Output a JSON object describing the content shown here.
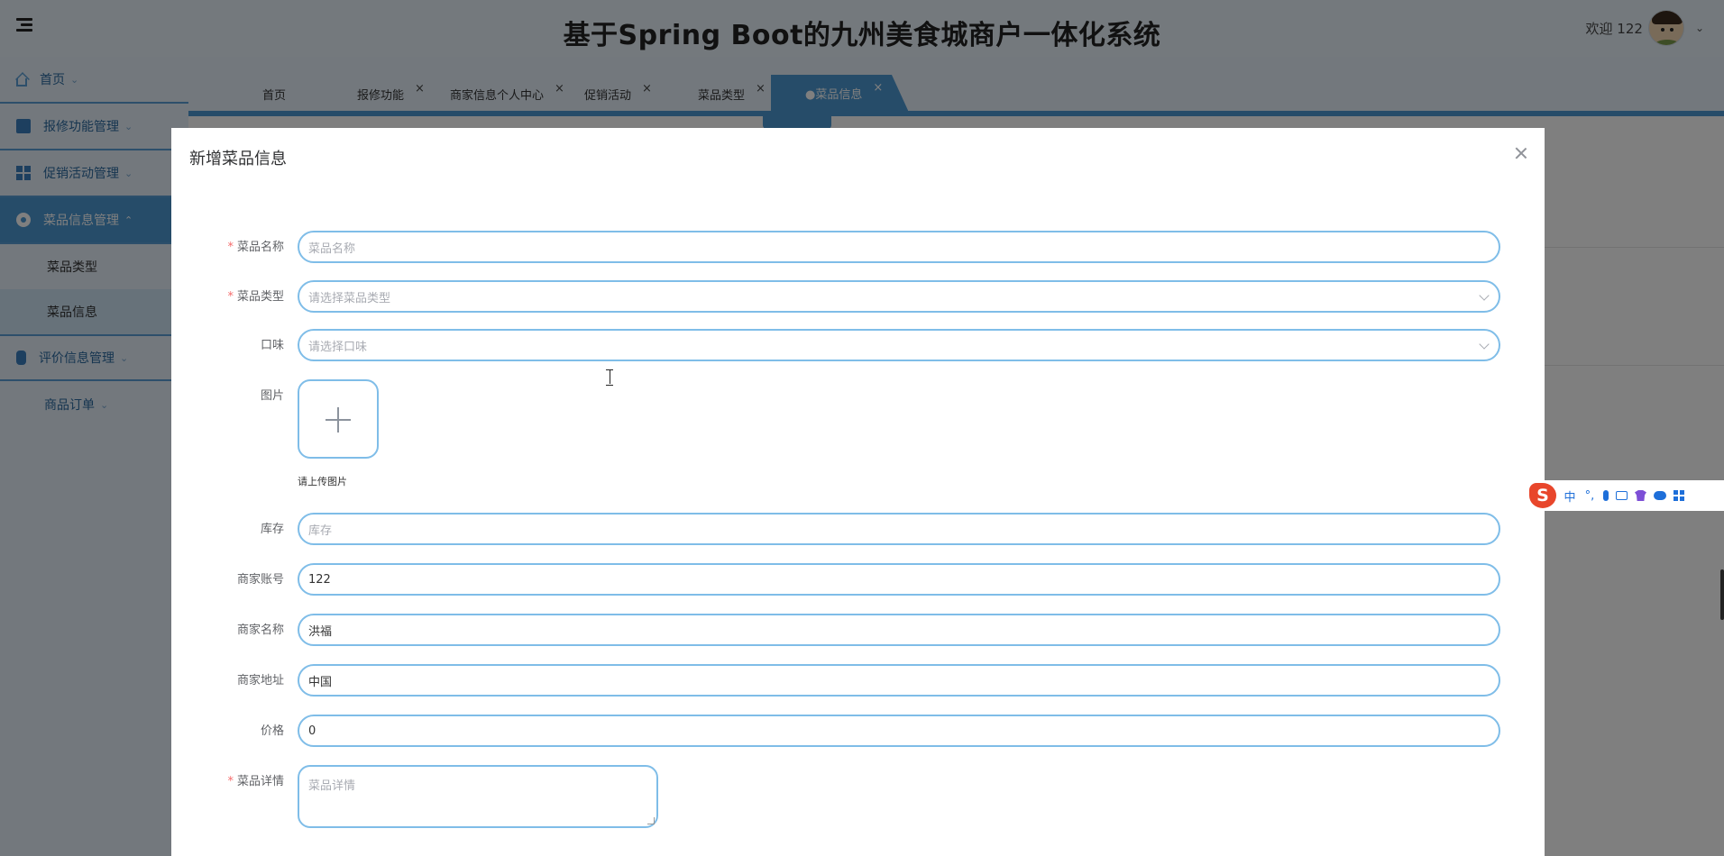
{
  "header": {
    "title": "基于Spring Boot的九州美食城商户一体化系统",
    "welcome": "欢迎 122"
  },
  "sidebar": {
    "items": [
      {
        "label": "首页",
        "icon": "home-icon"
      },
      {
        "label": "报修功能管理",
        "icon": "box-icon"
      },
      {
        "label": "促销活动管理",
        "icon": "grid-icon"
      },
      {
        "label": "菜品信息管理",
        "icon": "dish-icon",
        "expanded": true,
        "children": [
          {
            "label": "菜品类型"
          },
          {
            "label": "菜品信息",
            "selected": true
          }
        ]
      },
      {
        "label": "评价信息管理",
        "icon": "clipboard-icon"
      },
      {
        "label": "商品订单"
      }
    ]
  },
  "tabs": [
    {
      "label": "首页",
      "closable": false
    },
    {
      "label": "报修功能",
      "closable": true
    },
    {
      "label": "商家信息个人中心",
      "closable": true
    },
    {
      "label": "促销活动",
      "closable": true
    },
    {
      "label": "菜品类型",
      "closable": true
    },
    {
      "label": "●菜品信息",
      "closable": true,
      "active": true
    }
  ],
  "close_glyph": "×",
  "caret_down": "⌄",
  "dialog": {
    "title": "新增菜品信息",
    "fields": {
      "name": {
        "label": "菜品名称",
        "required": true,
        "placeholder": "菜品名称",
        "value": ""
      },
      "type": {
        "label": "菜品类型",
        "required": true,
        "placeholder": "请选择菜品类型"
      },
      "flavor": {
        "label": "口味",
        "required": false,
        "placeholder": "请选择口味"
      },
      "image": {
        "label": "图片",
        "tip": "请上传图片"
      },
      "stock": {
        "label": "库存",
        "placeholder": "库存",
        "value": ""
      },
      "merchant_account": {
        "label": "商家账号",
        "value": "122"
      },
      "merchant_name": {
        "label": "商家名称",
        "value": "洪福"
      },
      "merchant_address": {
        "label": "商家地址",
        "value": "中国"
      },
      "price": {
        "label": "价格",
        "value": "0"
      },
      "detail": {
        "label": "菜品详情",
        "required": true,
        "placeholder": "菜品详情"
      }
    }
  },
  "ime": {
    "logo": "S",
    "items": [
      "中",
      "°,"
    ]
  },
  "colors": {
    "accent": "#4c98d3",
    "field_border": "#7fbde8",
    "required": "#f56c6c"
  }
}
